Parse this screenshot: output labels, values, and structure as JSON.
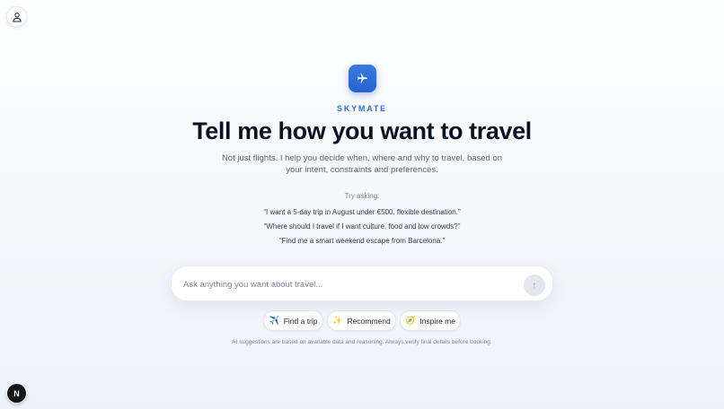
{
  "brand": {
    "name": "SKYMATE",
    "logo_icon": "airplane-icon",
    "accent_color": "#2f6fd6"
  },
  "header": {
    "profile_icon": "user-icon"
  },
  "hero": {
    "title": "Tell me how you want to travel",
    "subtitle": "Not just flights. I help you decide when, where and why to travel, based on your intent, constraints and preferences."
  },
  "examples": {
    "label": "Try asking:",
    "items": [
      "“I want a 5-day trip in August under €500, flexible destination.”",
      "“Where should I travel if I want culture, food and low crowds?”",
      "“Find me a smart weekend escape from Barcelona.”"
    ]
  },
  "search": {
    "placeholder": "Ask anything you want about travel...",
    "value": "",
    "send_icon": "arrow-up-icon",
    "send_glyph": "↑"
  },
  "chips": [
    {
      "label": "Find a trip",
      "icon": "airplane-icon",
      "glyph": "✈️"
    },
    {
      "label": "Recommend",
      "icon": "sparkles-icon",
      "glyph": "✨"
    },
    {
      "label": "Inspire me",
      "icon": "compass-icon",
      "glyph": "🧭"
    }
  ],
  "footer": {
    "disclaimer": "AI suggestions are based on available data and reasoning. Always verify final details before booking.",
    "dev_badge": "N"
  }
}
